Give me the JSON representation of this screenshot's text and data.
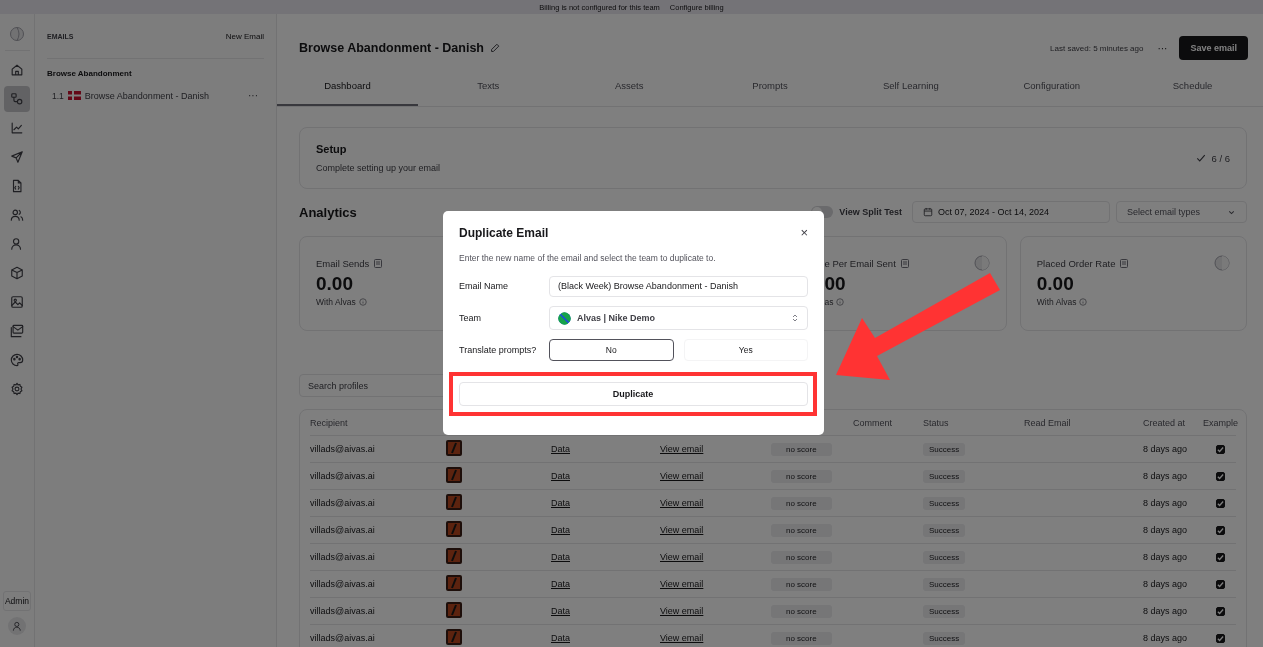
{
  "banner": {
    "message": "Billing is not configured for this team",
    "link": "Configure billing"
  },
  "rail": {
    "items": [
      {
        "kind": "home",
        "selected": false
      },
      {
        "kind": "workflow",
        "selected": true
      },
      {
        "kind": "chart",
        "selected": false
      },
      {
        "kind": "send",
        "selected": false
      },
      {
        "kind": "file",
        "selected": false
      },
      {
        "kind": "users",
        "selected": false
      },
      {
        "kind": "user",
        "selected": false
      },
      {
        "kind": "package",
        "selected": false
      },
      {
        "kind": "image",
        "selected": false
      },
      {
        "kind": "mail",
        "selected": false
      },
      {
        "kind": "palette",
        "selected": false
      },
      {
        "kind": "settings",
        "selected": false
      }
    ],
    "badge": "Admin"
  },
  "sidebar": {
    "heading": "EMAILS",
    "new_button": "New Email",
    "groups": [
      {
        "label": "Browse Abandonment",
        "children": [
          {
            "number": "1.1",
            "title": "Browse Abandonment - Danish",
            "menu": "···"
          }
        ]
      }
    ]
  },
  "header": {
    "title": "Browse Abandonment - Danish",
    "last_saved": "Last saved: 5 minutes ago",
    "menu": "···",
    "save_button": "Save email"
  },
  "tabs": [
    {
      "label": "Dashboard",
      "selected": true
    },
    {
      "label": "Texts",
      "selected": false
    },
    {
      "label": "Assets",
      "selected": false
    },
    {
      "label": "Prompts",
      "selected": false
    },
    {
      "label": "Self Learning",
      "selected": false
    },
    {
      "label": "Configuration",
      "selected": false
    },
    {
      "label": "Schedule",
      "selected": false
    }
  ],
  "setup": {
    "title": "Setup",
    "subtitle": "Complete setting up your email",
    "progress": "6 / 6",
    "complete": true
  },
  "analytics": {
    "title": "Analytics",
    "split_test": {
      "label": "View Split Test",
      "on": false
    },
    "date_range": "Oct 07, 2024 - Oct 14, 2024",
    "type_select": {
      "placeholder": "Select email types"
    }
  },
  "metrics": [
    {
      "title": "Email Sends",
      "value": "0.00",
      "note": "With Alvas",
      "cut": false
    },
    {
      "title": "e Per Email Sent",
      "value": "00",
      "note": "as",
      "cut": true,
      "spinner": true
    },
    {
      "title": "Placed Order Rate",
      "value": "0.00",
      "note": "With Alvas",
      "cut": false,
      "spinner": true
    }
  ],
  "search": {
    "placeholder": "Search profiles"
  },
  "table": {
    "columns": [
      "Recipient",
      "Comment",
      "Status",
      "Read Email",
      "Created at",
      "Example"
    ],
    "rows": [
      {
        "recipient": "villads@aivas.ai",
        "data": "Data",
        "view": "View email",
        "score": "no score",
        "status": "Success",
        "created": "8 days ago",
        "example": true
      },
      {
        "recipient": "villads@aivas.ai",
        "data": "Data",
        "view": "View email",
        "score": "no score",
        "status": "Success",
        "created": "8 days ago",
        "example": true
      },
      {
        "recipient": "villads@aivas.ai",
        "data": "Data",
        "view": "View email",
        "score": "no score",
        "status": "Success",
        "created": "8 days ago",
        "example": true
      },
      {
        "recipient": "villads@aivas.ai",
        "data": "Data",
        "view": "View email",
        "score": "no score",
        "status": "Success",
        "created": "8 days ago",
        "example": true
      },
      {
        "recipient": "villads@aivas.ai",
        "data": "Data",
        "view": "View email",
        "score": "no score",
        "status": "Success",
        "created": "8 days ago",
        "example": true
      },
      {
        "recipient": "villads@aivas.ai",
        "data": "Data",
        "view": "View email",
        "score": "no score",
        "status": "Success",
        "created": "8 days ago",
        "example": true
      },
      {
        "recipient": "villads@aivas.ai",
        "data": "Data",
        "view": "View email",
        "score": "no score",
        "status": "Success",
        "created": "8 days ago",
        "example": true
      },
      {
        "recipient": "villads@aivas.ai",
        "data": "Data",
        "view": "View email",
        "score": "no score",
        "status": "Success",
        "created": "8 days ago",
        "example": true
      }
    ]
  },
  "dialog": {
    "title": "Duplicate Email",
    "close": "×",
    "description": "Enter the new name of the email and select the team to duplicate to.",
    "name_label": "Email Name",
    "name_value": "(Black Week) Browse Abandonment - Danish",
    "team_label": "Team",
    "team_value": "Alvas | Nike Demo",
    "translate_label": "Translate prompts?",
    "translate_options": [
      {
        "label": "No",
        "selected": true
      },
      {
        "label": "Yes",
        "selected": false
      }
    ],
    "submit": "Duplicate"
  }
}
